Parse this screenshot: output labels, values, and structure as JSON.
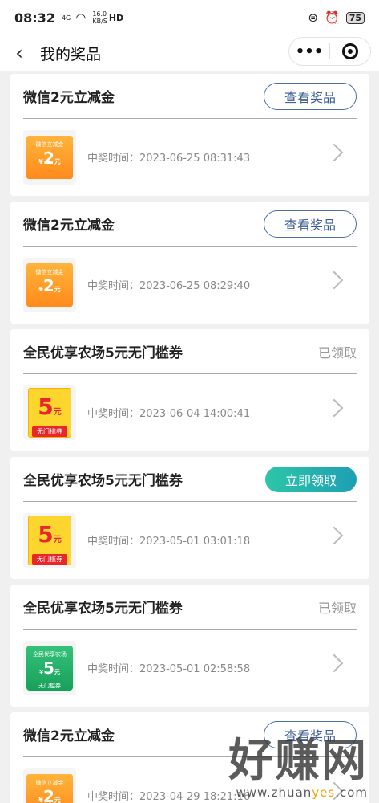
{
  "status_bar": {
    "time": "08:32",
    "network": "4G",
    "speed": "16.0",
    "speed_unit": "KB/S",
    "hd": "HD",
    "battery": "75"
  },
  "nav": {
    "title": "我的奖品",
    "more_label": "•••"
  },
  "prizes": [
    {
      "title": "微信2元立减金",
      "action": "查看奖品",
      "action_type": "view",
      "thumb": "wechat",
      "time_label": "中奖时间：",
      "time": "2023-06-25 08:31:43"
    },
    {
      "title": "微信2元立减金",
      "action": "查看奖品",
      "action_type": "view",
      "thumb": "wechat",
      "time_label": "中奖时间：",
      "time": "2023-06-25 08:29:40"
    },
    {
      "title": "全民优享农场5元无门槛券",
      "action": "已领取",
      "action_type": "claimed",
      "thumb": "farm-yellow",
      "time_label": "中奖时间：",
      "time": "2023-06-04 14:00:41"
    },
    {
      "title": "全民优享农场5元无门槛券",
      "action": "立即领取",
      "action_type": "claim",
      "thumb": "farm-yellow",
      "time_label": "中奖时间：",
      "time": "2023-05-01 03:01:18"
    },
    {
      "title": "全民优享农场5元无门槛券",
      "action": "已领取",
      "action_type": "claimed",
      "thumb": "farm-green",
      "time_label": "中奖时间：",
      "time": "2023-05-01 02:58:58"
    },
    {
      "title": "微信2元立减金",
      "action": "查看奖品",
      "action_type": "view",
      "thumb": "wechat",
      "time_label": "中奖时间：",
      "time": "2023-04-29 18:21:16"
    }
  ],
  "thumb_text": {
    "wechat_top": "微信立减金",
    "wechat_amt": "2",
    "wechat_unit": "元",
    "currency": "¥",
    "farm_amt": "5",
    "farm_unit": "元",
    "farm_band": "无门槛券",
    "farm_green_top": "全民优享农场",
    "farm_green_band": "无门槛券"
  },
  "watermark": {
    "text": "好赚网",
    "site_prefix": "www.zhuan",
    "site_highlight": "yes",
    "site_suffix": ".com"
  }
}
